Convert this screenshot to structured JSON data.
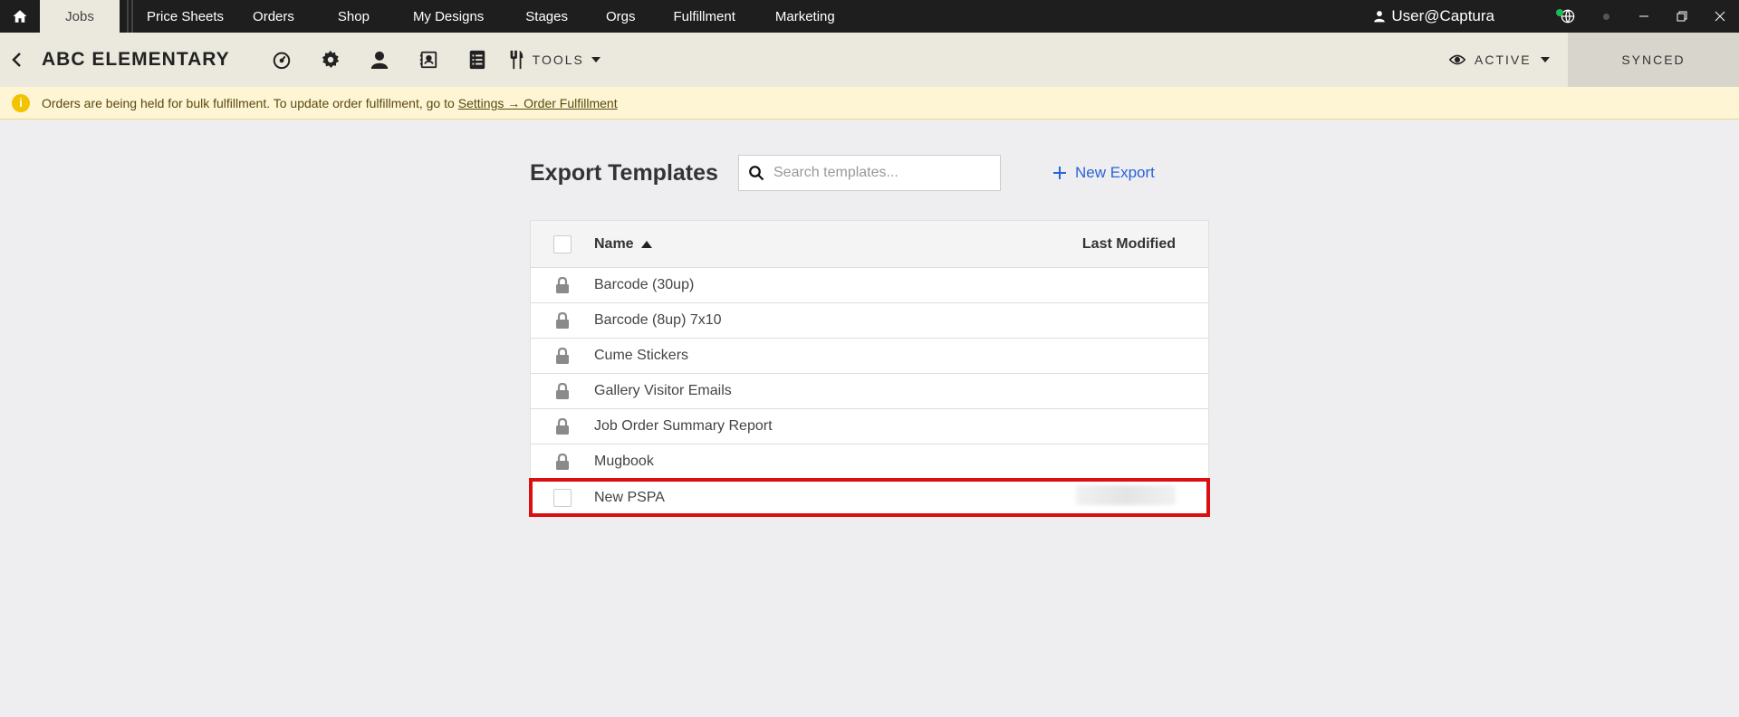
{
  "topnav": {
    "tabs": [
      "Jobs",
      "Price Sheets",
      "Orders",
      "Shop",
      "My Designs",
      "Stages",
      "Orgs",
      "Fulfillment",
      "Marketing"
    ],
    "active_tab": "Jobs",
    "user": "User@Captura",
    "status_color": "#1db954"
  },
  "toolbar": {
    "job_title": "ABC ELEMENTARY",
    "icons": [
      "dashboard-icon",
      "gear-icon",
      "person-icon",
      "contacts-icon",
      "list-icon"
    ],
    "tools_label": "TOOLS",
    "status_label": "ACTIVE",
    "sync_label": "SYNCED"
  },
  "banner": {
    "message": "Orders are being held for bulk fulfillment. To update order fulfillment, go to",
    "link_text": "Settings → Order Fulfillment"
  },
  "main": {
    "title": "Export Templates",
    "search_placeholder": "Search templates...",
    "new_export_label": "New Export",
    "columns": {
      "name": "Name",
      "last_modified": "Last Modified"
    },
    "rows": [
      {
        "name": "Barcode (30up)",
        "locked": true
      },
      {
        "name": "Barcode (8up) 7x10",
        "locked": true
      },
      {
        "name": "Cume Stickers",
        "locked": true
      },
      {
        "name": "Gallery Visitor Emails",
        "locked": true
      },
      {
        "name": "Job Order Summary Report",
        "locked": true
      },
      {
        "name": "Mugbook",
        "locked": true
      },
      {
        "name": "New PSPA",
        "locked": false,
        "highlighted": true
      }
    ]
  },
  "colors": {
    "highlight": "#d90f12",
    "link": "#2a62d9",
    "banner_bg": "#fdf5d4"
  }
}
